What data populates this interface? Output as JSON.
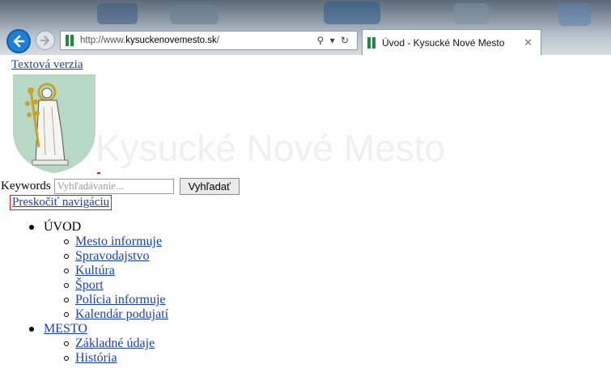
{
  "browser": {
    "url_prefix": "http://www.",
    "url_host": "kysuckenovemesto.sk",
    "url_suffix": "/",
    "address_tools": "⚲ ▾ ↻",
    "tab_title": "Úvod - Kysucké Nové Mesto",
    "tab_close": "✕"
  },
  "header": {
    "text_version_link": "Textová verzia",
    "watermark_title": "Kysucké Nové Mesto"
  },
  "search": {
    "label": "Keywords",
    "placeholder": "Vyhľadávanie...",
    "button": "Vyhľadať"
  },
  "skip_link": "Preskočiť navigáciu",
  "menu": [
    {
      "label": "ÚVOD",
      "is_link": false,
      "items": [
        "Mesto informuje",
        "Spravodajstvo",
        "Kultúra",
        "Šport",
        "Polícia informuje",
        "Kalendár podujatí"
      ]
    },
    {
      "label": "MESTO",
      "is_link": true,
      "items": [
        "Základné údaje",
        "História"
      ]
    }
  ],
  "colors": {
    "link": "#1a3fb3",
    "focus_outline": "#d21f1f",
    "crest_bg": "#b6d8c4",
    "favicon_green": "#1f8a3a"
  }
}
